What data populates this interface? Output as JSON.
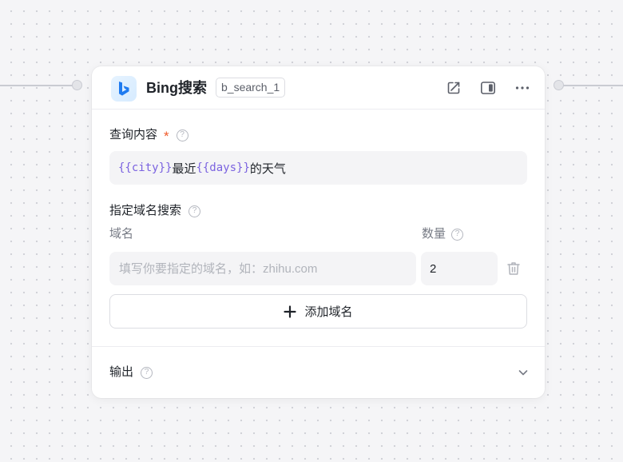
{
  "node": {
    "title": "Bing搜索",
    "id": "b_search_1",
    "logo_icon": "bing-logo-icon",
    "brand_color": "#1e7bf0"
  },
  "header_actions": [
    {
      "name": "open-external-icon"
    },
    {
      "name": "side-panel-icon"
    },
    {
      "name": "more-icon"
    }
  ],
  "query": {
    "label": "查询内容",
    "required_mark": "*",
    "parts": [
      "{{city}}",
      "最近",
      "{{days}}",
      "的天气"
    ],
    "variable_color": "#7b63e0"
  },
  "domain_search": {
    "label": "指定域名搜索",
    "col_domain": "域名",
    "col_count": "数量",
    "domain_placeholder": "填写你要指定的域名，如：zhihu.com",
    "domain_value": "",
    "count_value": "2",
    "add_label": "添加域名"
  },
  "output": {
    "label": "输出"
  }
}
